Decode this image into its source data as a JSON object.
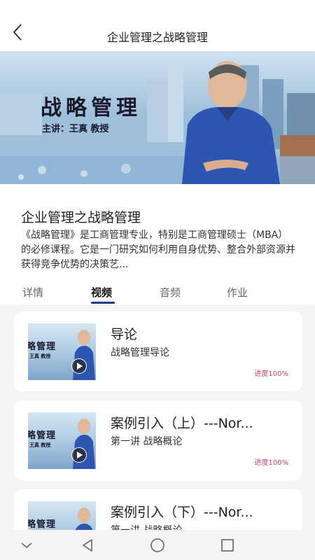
{
  "header": {
    "title": "企业管理之战略管理"
  },
  "banner": {
    "title": "战略管理",
    "subtitle": "主讲：王真  教授"
  },
  "course": {
    "name": "企业管理之战略管理",
    "description": "《战略管理》是工商管理专业，特别是工商管理硕士（MBA）的必修课程。它是一门研究如何利用自身优势、整合外部资源并获得竞争优势的决策艺..."
  },
  "tabs": [
    {
      "label": "详情"
    },
    {
      "label": "视频"
    },
    {
      "label": "音频"
    },
    {
      "label": "作业"
    }
  ],
  "lessons": [
    {
      "title": "导论",
      "subtitle": "战略管理导论",
      "progress": "进度100%",
      "thumb_title": "略管理",
      "thumb_sub": "王真  教授"
    },
    {
      "title": "案例引入（上）---Nor...",
      "subtitle": "第一讲  战略概论",
      "progress": "进度100%",
      "thumb_title": "略管理",
      "thumb_sub": "王真  教授"
    },
    {
      "title": "案例引入（下）---Nor...",
      "subtitle": "第一讲  战略概论",
      "progress": "",
      "thumb_title": "略管理",
      "thumb_sub": ""
    }
  ],
  "colors": {
    "accent": "#1f3b8c",
    "progress": "#c8407a"
  }
}
